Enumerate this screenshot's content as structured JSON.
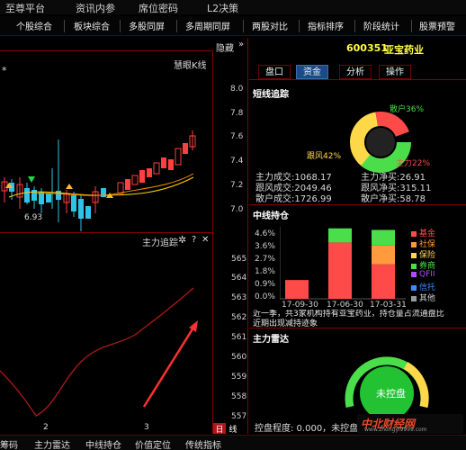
{
  "top_menu": {
    "items": [
      "至尊平台",
      "资讯内参",
      "席位密码",
      "L2决策"
    ]
  },
  "toolbar": {
    "items": [
      "个股综合",
      "板块综合",
      "多股同屏",
      "多周期同屏",
      "两股对比",
      "指标排序",
      "阶段统计",
      "股票预警"
    ]
  },
  "chart": {
    "hide_label": "隐藏",
    "hide_glyph": "»",
    "indicator_name": "慧眼K线",
    "star": "*",
    "price_ticks": [
      "8.0",
      "7.8",
      "7.6",
      "7.4",
      "7.2",
      "7.0"
    ],
    "low_label": "6.93",
    "sub_title": "主力追踪",
    "sub_gear": "✲",
    "sub_q": "?",
    "sub_close": "✕",
    "sub_ticks": [
      "565",
      "564",
      "563",
      "562",
      "561",
      "560",
      "559",
      "558",
      "557"
    ],
    "x_labels": [
      "2",
      "3"
    ],
    "tag1": "日",
    "tag2": "线"
  },
  "stock": {
    "code": "600351",
    "name": "亚宝药业"
  },
  "tabs": [
    {
      "label": "盘口",
      "active": false
    },
    {
      "label": "资金",
      "active": true
    },
    {
      "label": "分析",
      "active": false
    },
    {
      "label": "操作",
      "active": false
    }
  ],
  "short_track": {
    "title": "短线追踪",
    "donut_labels": {
      "retail": "散户36%",
      "follow": "跟风42%",
      "main": "主力22%"
    },
    "stats": [
      {
        "left": "主力成交:1068.17",
        "right": "主力净买:26.91"
      },
      {
        "left": "跟风成交:2049.46",
        "right": "跟风净买:315.11"
      },
      {
        "left": "散户成交:1726.99",
        "right": "散户净买:58.78"
      }
    ]
  },
  "mid_hold": {
    "title": "中线持仓",
    "y_ticks": [
      "4.6%",
      "3.6%",
      "2.7%",
      "1.8%",
      "0.9%",
      "0.0%"
    ],
    "x_labels": [
      "17-09-30",
      "17-06-30",
      "17-03-31"
    ],
    "legend": [
      {
        "name": "基金",
        "color": "#ff4a4a"
      },
      {
        "name": "社保",
        "color": "#ff9a3d"
      },
      {
        "name": "保险",
        "color": "#ffd84a"
      },
      {
        "name": "券商",
        "color": "#4adf4a"
      },
      {
        "name": "QFII",
        "color": "#b24aff"
      },
      {
        "name": "信托",
        "color": "#3d8bff"
      },
      {
        "name": "其他",
        "color": "#9a9a9a"
      }
    ],
    "text_line1": "近一季，共3家机构持有亚宝药业，持仓量占流通盘比",
    "text_line2": "近期出现减持迹象"
  },
  "main_radar": {
    "title": "主力雷达",
    "center_label": "未控盘",
    "bottom_text": "控盘程度: 0.000，未控盘"
  },
  "bottom_bar": {
    "items": [
      "筹码",
      "主力雷达",
      "中线持仓",
      "价值定位",
      "传统指标"
    ]
  },
  "watermark": {
    "logo": "中北财经网",
    "url": "www.zhongyi9999.com"
  },
  "chart_data": [
    {
      "type": "table",
      "title": "",
      "categories": [
        "17-09-30",
        "17-06-30",
        "17-03-31"
      ],
      "series": [
        {
          "name": "基金",
          "values": [
            1.2,
            3.6,
            2.2
          ]
        },
        {
          "name": "社保",
          "values": [
            0,
            0,
            1.2
          ]
        },
        {
          "name": "券商",
          "values": [
            0,
            0.9,
            1.0
          ]
        }
      ],
      "ylim": [
        0,
        4.6
      ]
    }
  ]
}
